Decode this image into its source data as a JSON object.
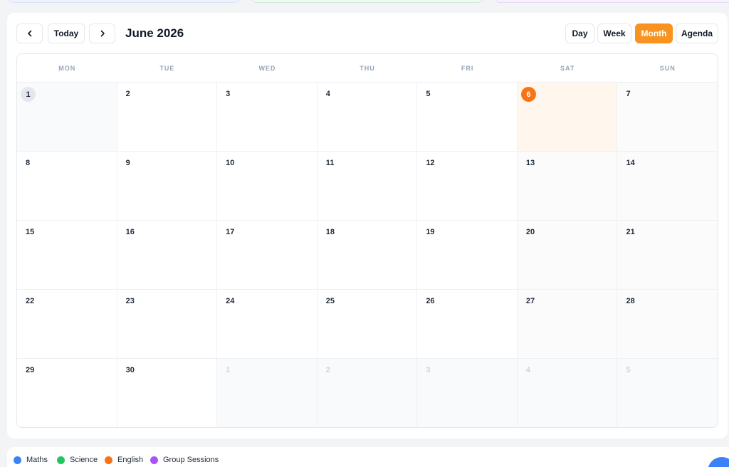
{
  "toolbar": {
    "prev_icon": "chevron-left-icon",
    "next_icon": "chevron-right-icon",
    "today_label": "Today",
    "title": "June 2026",
    "views": [
      "Day",
      "Week",
      "Month",
      "Agenda"
    ],
    "active_view": "Month"
  },
  "calendar": {
    "weekdays": [
      "MON",
      "TUE",
      "WED",
      "THU",
      "FRI",
      "SAT",
      "SUN"
    ],
    "weeks": [
      [
        "1",
        "2",
        "3",
        "4",
        "5",
        "6",
        "7"
      ],
      [
        "8",
        "9",
        "10",
        "11",
        "12",
        "13",
        "14"
      ],
      [
        "15",
        "16",
        "17",
        "18",
        "19",
        "20",
        "21"
      ],
      [
        "22",
        "23",
        "24",
        "25",
        "26",
        "27",
        "28"
      ],
      [
        "29",
        "30",
        "1",
        "2",
        "3",
        "4",
        "5"
      ]
    ],
    "today": "6"
  },
  "legend": [
    {
      "label": "Maths",
      "color": "#3b82f6"
    },
    {
      "label": "Science",
      "color": "#22c55e"
    },
    {
      "label": "English",
      "color": "#f97316"
    },
    {
      "label": "Group Sessions",
      "color": "#a855f7"
    }
  ],
  "colors": {
    "accent": "#f7931e",
    "today_badge": "#f97316"
  }
}
